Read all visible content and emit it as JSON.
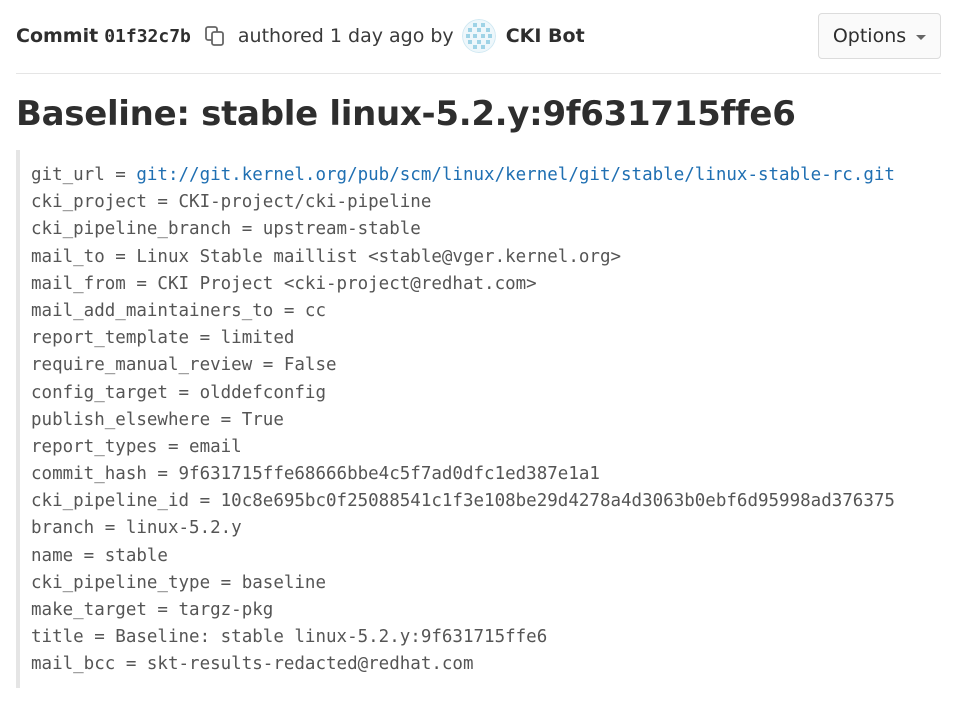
{
  "header": {
    "commit_label": "Commit",
    "commit_sha": "01f32c7b",
    "authored_text": "authored 1 day ago by",
    "author_name": "CKI Bot",
    "options_label": "Options"
  },
  "title": "Baseline: stable linux-5.2.y:9f631715ffe6",
  "description": {
    "git_url_key": "git_url = ",
    "git_url_link": "git://git.kernel.org/pub/scm/linux/kernel/git/stable/linux-stable-rc.git",
    "lines": [
      "cki_project = CKI-project/cki-pipeline",
      "cki_pipeline_branch = upstream-stable",
      "mail_to = Linux Stable maillist <stable@vger.kernel.org>",
      "mail_from = CKI Project <cki-project@redhat.com>",
      "mail_add_maintainers_to = cc",
      "report_template = limited",
      "require_manual_review = False",
      "config_target = olddefconfig",
      "publish_elsewhere = True",
      "report_types = email",
      "commit_hash = 9f631715ffe68666bbe4c5f7ad0dfc1ed387e1a1",
      "cki_pipeline_id = 10c8e695bc0f25088541c1f3e108be29d4278a4d3063b0ebf6d95998ad376375",
      "branch = linux-5.2.y",
      "name = stable",
      "cki_pipeline_type = baseline",
      "make_target = targz-pkg",
      "title = Baseline: stable linux-5.2.y:9f631715ffe6",
      "mail_bcc = skt-results-redacted@redhat.com"
    ]
  },
  "icons": {
    "copy": "copy-icon",
    "avatar": "avatar-identicon",
    "caret": "caret-down-icon"
  },
  "colors": {
    "link": "#1f6fb2",
    "text": "#2e2e2e",
    "avatar": "#9fd3e6"
  }
}
